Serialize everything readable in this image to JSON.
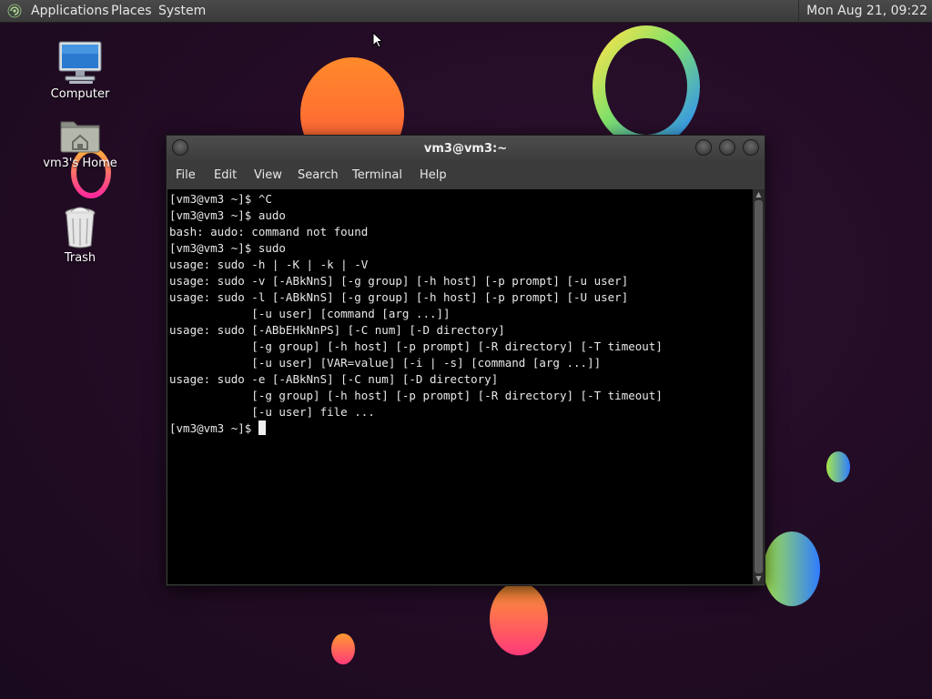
{
  "panel": {
    "menus": [
      "Applications",
      "Places",
      "System"
    ],
    "clock": "Mon Aug 21, 09:22"
  },
  "desktop": {
    "icons": [
      {
        "label": "Computer",
        "icon": "computer-icon"
      },
      {
        "label": "vm3's Home",
        "icon": "home-folder-icon"
      },
      {
        "label": "Trash",
        "icon": "trash-icon"
      }
    ]
  },
  "terminal": {
    "title": "vm3@vm3:~",
    "menus": [
      "File",
      "Edit",
      "View",
      "Search",
      "Terminal",
      "Help"
    ],
    "lines": [
      "[vm3@vm3 ~]$ ^C",
      "[vm3@vm3 ~]$ audo",
      "bash: audo: command not found",
      "[vm3@vm3 ~]$ sudo",
      "usage: sudo -h | -K | -k | -V",
      "usage: sudo -v [-ABkNnS] [-g group] [-h host] [-p prompt] [-u user]",
      "usage: sudo -l [-ABkNnS] [-g group] [-h host] [-p prompt] [-U user]",
      "            [-u user] [command [arg ...]]",
      "usage: sudo [-ABbEHkNnPS] [-C num] [-D directory]",
      "            [-g group] [-h host] [-p prompt] [-R directory] [-T timeout]",
      "            [-u user] [VAR=value] [-i | -s] [command [arg ...]]",
      "usage: sudo -e [-ABkNnS] [-C num] [-D directory]",
      "            [-g group] [-h host] [-p prompt] [-R directory] [-T timeout]",
      "            [-u user] file ..."
    ],
    "prompt": "[vm3@vm3 ~]$ "
  }
}
